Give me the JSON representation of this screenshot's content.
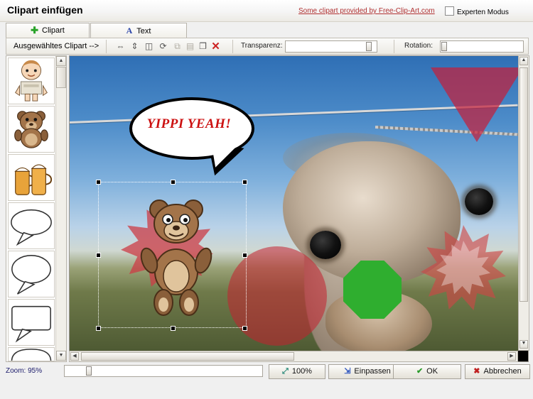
{
  "window": {
    "title": "Clipart einfügen",
    "credit_link": "Some clipart provided by Free-Clip-Art.com",
    "expert_mode_label": "Experten Modus"
  },
  "tabs": [
    {
      "label": "Clipart",
      "icon": "plus-icon"
    },
    {
      "label": "Text",
      "icon": "text-icon"
    }
  ],
  "toolbar": {
    "selected_clipart_label": "Ausgewähltes Clipart -->",
    "icons": [
      "flip-horizontal-icon",
      "flip-vertical-icon",
      "mirror-icon",
      "rotate-icon",
      "copy-icon",
      "paste-icon",
      "duplicate-icon",
      "delete-icon"
    ],
    "transparency_label": "Transparenz:",
    "transparency_value": "100",
    "rotation_label": "Rotation:",
    "rotation_value": "0"
  },
  "clipart_list": {
    "items": [
      "baby-clipart",
      "teddy-bear-clipart",
      "beer-mugs-clipart",
      "speech-bubble-oval-clipart",
      "speech-bubble-round-clipart",
      "speech-bubble-square-clipart",
      "speech-bubble-partial-clipart"
    ]
  },
  "canvas": {
    "photo_description": "ostrich-photo",
    "overlays": [
      {
        "name": "speech-bubble-overlay",
        "text": "YIPPI YEAH!"
      },
      {
        "name": "triangle-overlay",
        "color": "#c4203c"
      },
      {
        "name": "red-circle-overlay",
        "color": "#c42030"
      },
      {
        "name": "green-octagon-overlay",
        "color": "#2fae2f"
      },
      {
        "name": "red-star-overlay",
        "color": "#ce4646"
      },
      {
        "name": "teddy-bear-overlay",
        "selected": true
      }
    ]
  },
  "statusbar": {
    "zoom_label": "Zoom: 95%",
    "buttons": [
      {
        "name": "zoom-100-button",
        "label": "100%",
        "icon": "zoom-icon"
      },
      {
        "name": "fit-button",
        "label": "Einpassen",
        "icon": "fit-icon"
      },
      {
        "name": "ok-button",
        "label": "OK",
        "icon": "check-icon"
      },
      {
        "name": "cancel-button",
        "label": "Abbrechen",
        "icon": "x-icon"
      }
    ]
  }
}
